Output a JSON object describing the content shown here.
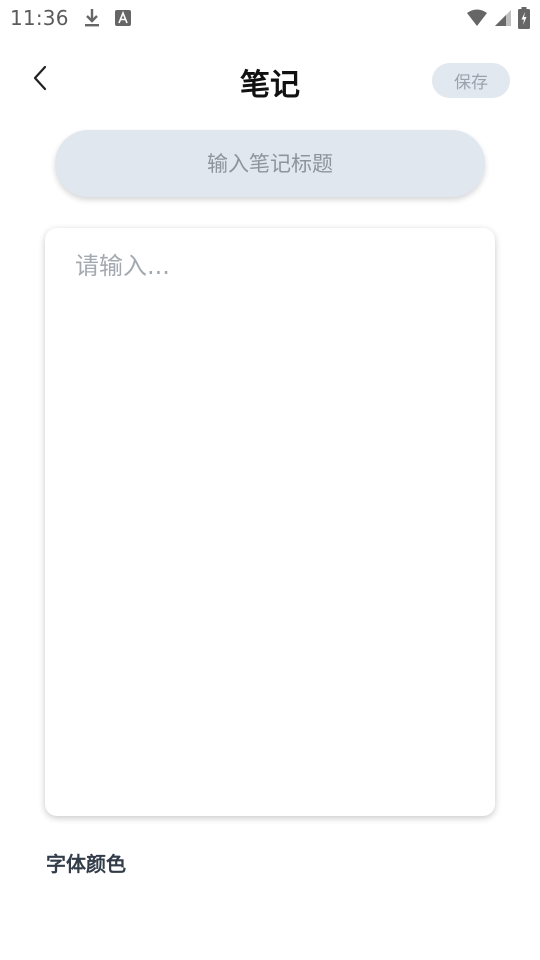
{
  "status_bar": {
    "time": "11:36",
    "left_icons": [
      "download-icon",
      "font-a-icon"
    ],
    "right_icons": [
      "wifi-icon",
      "signal-icon",
      "battery-charging-icon"
    ]
  },
  "header": {
    "title": "笔记",
    "save_label": "保存",
    "back_icon": "chevron-left-icon"
  },
  "title_input": {
    "placeholder": "输入笔记标题",
    "value": ""
  },
  "content": {
    "placeholder": "请输入...",
    "value": ""
  },
  "font_color": {
    "label": "字体颜色"
  },
  "colors": {
    "save_bg": "#e2e8ef",
    "save_text": "#9aa3ad",
    "title_input_bg": "#e1e7ef",
    "label_text": "#333d4a"
  }
}
